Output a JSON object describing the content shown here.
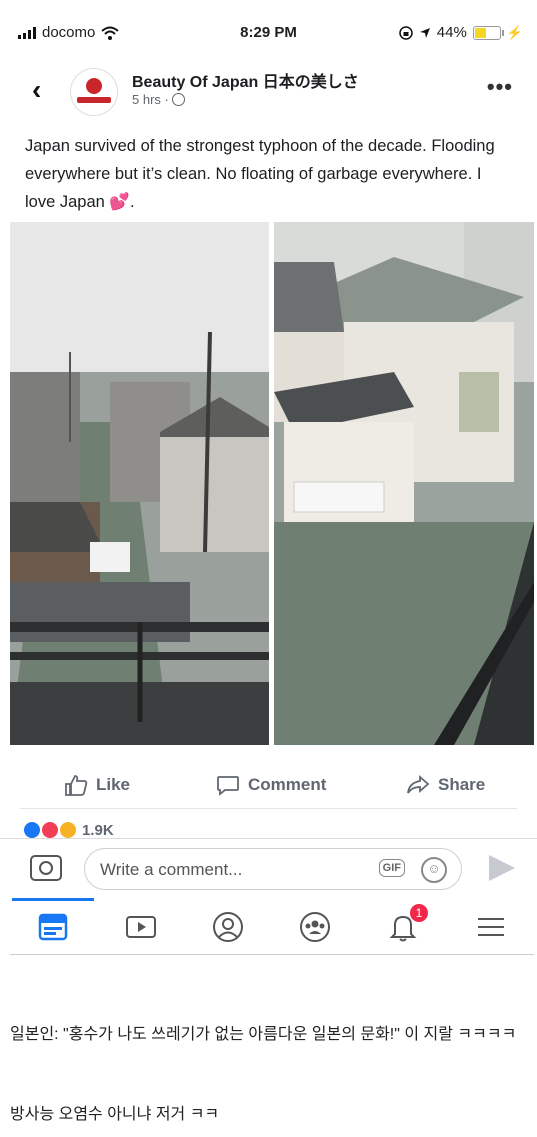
{
  "status_bar": {
    "carrier": "docomo",
    "time": "8:29 PM",
    "battery_percent": "44%",
    "battery_level": 0.44,
    "icons": [
      "signal-icon",
      "wifi-icon",
      "lock-rotation-icon",
      "location-icon",
      "battery-icon",
      "charging-icon"
    ]
  },
  "post": {
    "page_name": "Beauty Of Japan 日本の美しさ",
    "time_ago": "5 hrs ·",
    "caption": "Japan survived of the strongest typhoon of the decade. Flooding everywhere but it’s clean. No floating of garbage everywhere. I love Japan",
    "caption_end": ".",
    "emoji": "💕"
  },
  "actions": {
    "like": "Like",
    "comment": "Comment",
    "share": "Share"
  },
  "reactions": {
    "count": "1.9K"
  },
  "comment_bar": {
    "placeholder": "Write a comment...",
    "gif_label": "GIF"
  },
  "tabbar": {
    "notification_count": "1"
  },
  "korean_comments": {
    "line1": "일본인: \"홍수가 나도 쓰레기가 없는 아름다운 일본의 문화!\" 이 지랄 ㅋㅋㅋㅋ",
    "line2": "방사능 오염수 아니냐 저거 ㅋㅋ"
  },
  "colors": {
    "accent": "#1877f2",
    "badge": "#f02849",
    "water": "#6f7f72"
  }
}
